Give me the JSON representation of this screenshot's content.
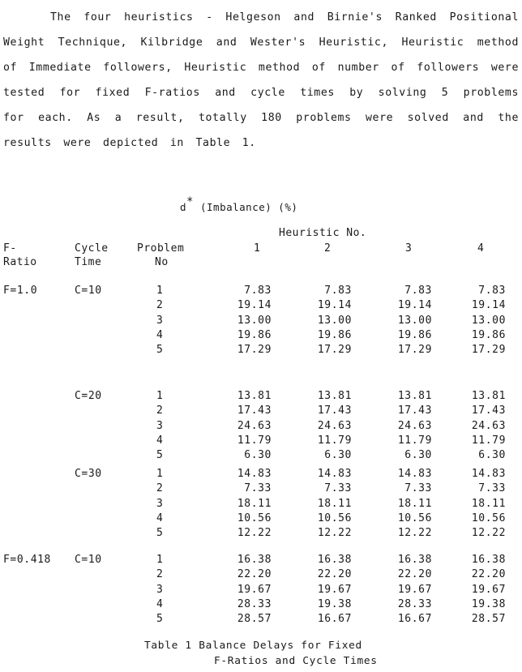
{
  "paragraph": "The four heuristics - Helgeson and Birnie's Ranked Positional Weight Technique, Kilbridge and Wester's Heuristic, Heuristic method of Immediate followers, Heuristic method of number of followers were tested for fixed F-ratios and cycle times by solving 5 problems for each. As a result, totally 180 problems were solved and the results were depicted in Table 1.",
  "table": {
    "subtitle_symbol": "d",
    "subtitle_sup": "*",
    "subtitle_text": "(Imbalance) (%)",
    "group_header": "Heuristic No.",
    "headers": {
      "f_ratio_line1": "F-",
      "f_ratio_line2": "Ratio",
      "cycle_line1": "Cycle",
      "cycle_line2": "Time",
      "problem_line1": "Problem",
      "problem_line2": "No",
      "h1": "1",
      "h2": "2",
      "h3": "3",
      "h4": "4"
    },
    "blocks": [
      {
        "f_ratio": "F=1.0",
        "cycle": "C=10",
        "rows": [
          {
            "problem": "1",
            "values": [
              "7.83",
              "7.83",
              "7.83",
              "7.83"
            ]
          },
          {
            "problem": "2",
            "values": [
              "19.14",
              "19.14",
              "19.14",
              "19.14"
            ]
          },
          {
            "problem": "3",
            "values": [
              "13.00",
              "13.00",
              "13.00",
              "13.00"
            ]
          },
          {
            "problem": "4",
            "values": [
              "19.86",
              "19.86",
              "19.86",
              "19.86"
            ]
          },
          {
            "problem": "5",
            "values": [
              "17.29",
              "17.29",
              "17.29",
              "17.29"
            ]
          }
        ]
      },
      {
        "f_ratio": "",
        "cycle": "C=20",
        "rows": [
          {
            "problem": "1",
            "values": [
              "13.81",
              "13.81",
              "13.81",
              "13.81"
            ]
          },
          {
            "problem": "2",
            "values": [
              "17.43",
              "17.43",
              "17.43",
              "17.43"
            ]
          },
          {
            "problem": "3",
            "values": [
              "24.63",
              "24.63",
              "24.63",
              "24.63"
            ]
          },
          {
            "problem": "4",
            "values": [
              "11.79",
              "11.79",
              "11.79",
              "11.79"
            ]
          },
          {
            "problem": "5",
            "values": [
              "6.30",
              "6.30",
              "6.30",
              "6.30"
            ]
          }
        ]
      },
      {
        "f_ratio": "",
        "cycle": "C=30",
        "rows": [
          {
            "problem": "1",
            "values": [
              "14.83",
              "14.83",
              "14.83",
              "14.83"
            ]
          },
          {
            "problem": "2",
            "values": [
              "7.33",
              "7.33",
              "7.33",
              "7.33"
            ]
          },
          {
            "problem": "3",
            "values": [
              "18.11",
              "18.11",
              "18.11",
              "18.11"
            ]
          },
          {
            "problem": "4",
            "values": [
              "10.56",
              "10.56",
              "10.56",
              "10.56"
            ]
          },
          {
            "problem": "5",
            "values": [
              "12.22",
              "12.22",
              "12.22",
              "12.22"
            ]
          }
        ]
      },
      {
        "f_ratio": "F=0.418",
        "cycle": "C=10",
        "rows": [
          {
            "problem": "1",
            "values": [
              "16.38",
              "16.38",
              "16.38",
              "16.38"
            ]
          },
          {
            "problem": "2",
            "values": [
              "22.20",
              "22.20",
              "22.20",
              "22.20"
            ]
          },
          {
            "problem": "3",
            "values": [
              "19.67",
              "19.67",
              "19.67",
              "19.67"
            ]
          },
          {
            "problem": "4",
            "values": [
              "28.33",
              "19.38",
              "28.33",
              "19.38"
            ]
          },
          {
            "problem": "5",
            "values": [
              "28.57",
              "16.67",
              "16.67",
              "28.57"
            ]
          }
        ]
      }
    ],
    "caption_line1": "Table 1 Balance Delays for Fixed",
    "caption_line2": "F-Ratios and Cycle Times"
  }
}
